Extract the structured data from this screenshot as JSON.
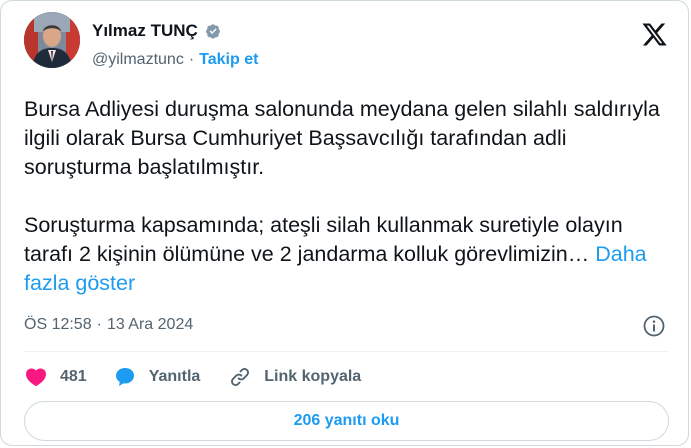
{
  "author": {
    "name": "Yılmaz TUNÇ",
    "handle": "@yilmaztunc",
    "separator": "·",
    "follow_label": "Takip et",
    "verified_color": "#829aab",
    "avatar": "profile-photo"
  },
  "platform_icon": "x-logo-icon",
  "tweet": {
    "paragraph_1": "Bursa Adliyesi duruşma salonunda meydana gelen silahlı saldırıyla ilgili olarak Bursa Cumhuriyet Başsavcılığı tarafından adli soruşturma başlatılmıştır.",
    "paragraph_2": "Soruşturma kapsamında; ateşli silah kullanmak suretiyle olayın tarafı 2 kişinin ölümüne ve 2 jandarma kolluk görevlimizin…",
    "show_more": "Daha fazla göster"
  },
  "meta": {
    "time": "ÖS 12:58",
    "separator": "·",
    "date": "13 Ara 2024",
    "info_icon": "info-icon"
  },
  "actions": {
    "likes": "481",
    "reply_label": "Yanıtla",
    "copy_link_label": "Link kopyala"
  },
  "read_replies": "206 yanıtı oku",
  "colors": {
    "link_blue": "#1d9bf0",
    "like_red": "#f91880",
    "text_dark": "#0f1419",
    "text_gray": "#536471",
    "border": "#cfd9de"
  }
}
